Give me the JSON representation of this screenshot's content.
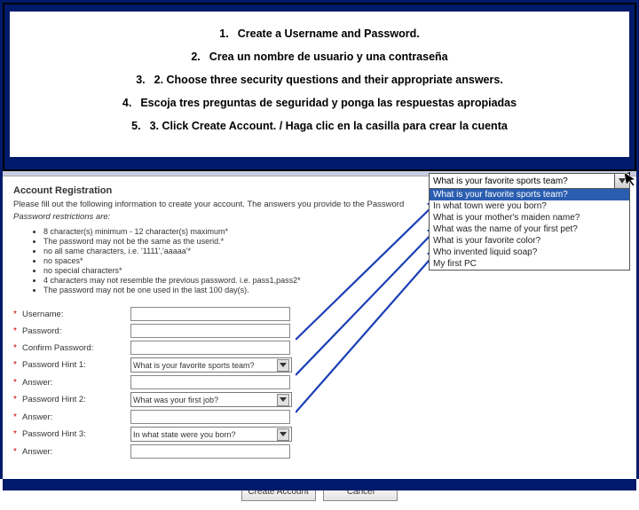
{
  "instructions": {
    "i1_num": "1.",
    "i1_txt": "Create a Username and Password.",
    "i2_num": "2.",
    "i2_txt": "Crea un nombre de usuario y una contraseña",
    "i3_num": "3.",
    "i3_txt": "2. Choose three security questions and their appropriate answers.",
    "i4_num": "4.",
    "i4_txt": "Escoja tres preguntas de seguridad y ponga las respuestas apropiadas",
    "i5_num": "5.",
    "i5_txt": "3. Click Create Account. / Haga clic en la casilla para crear la cuenta"
  },
  "panel": {
    "title": "Account Registration",
    "desc": "Please fill out the following information to create your account. The answers you provide to the Password",
    "desc2": "Password restrictions are:",
    "rules": {
      "r1": "8 character(s) minimum - 12 character(s) maximum*",
      "r2": "The password may not be the same as the userid.*",
      "r3": "no all same characters, i.e. '1111','aaaaa'*",
      "r4": "no spaces*",
      "r5": "no special characters*",
      "r6": "4 characters may not resemble the previous password. i.e. pass1,pass2*",
      "r7": "The password may not be one used in the last 100 day(s)."
    }
  },
  "form": {
    "username_label": "Username:",
    "password_label": "Password:",
    "confirm_label": "Confirm Password:",
    "hint1_label": "Password Hint 1:",
    "hint2_label": "Password Hint 2:",
    "hint3_label": "Password Hint 3:",
    "answer_label": "Answer:",
    "hint1_value": "What is your favorite sports team?",
    "hint2_value": "What was your first job?",
    "hint3_value": "In what state were you born?",
    "create_btn": "Create Account",
    "cancel_btn": "Cancel",
    "asterisk": "*"
  },
  "dropdown": {
    "selected": "What is your favorite sports team?",
    "opt1": "What is your favorite sports team?",
    "opt2": "In what town were you born?",
    "opt3": "What is your mother's maiden name?",
    "opt4": "What was the name of your first pet?",
    "opt5": "What is your favorite color?",
    "opt6": "Who invented liquid soap?",
    "opt7": "My first PC",
    "badge": "1"
  }
}
